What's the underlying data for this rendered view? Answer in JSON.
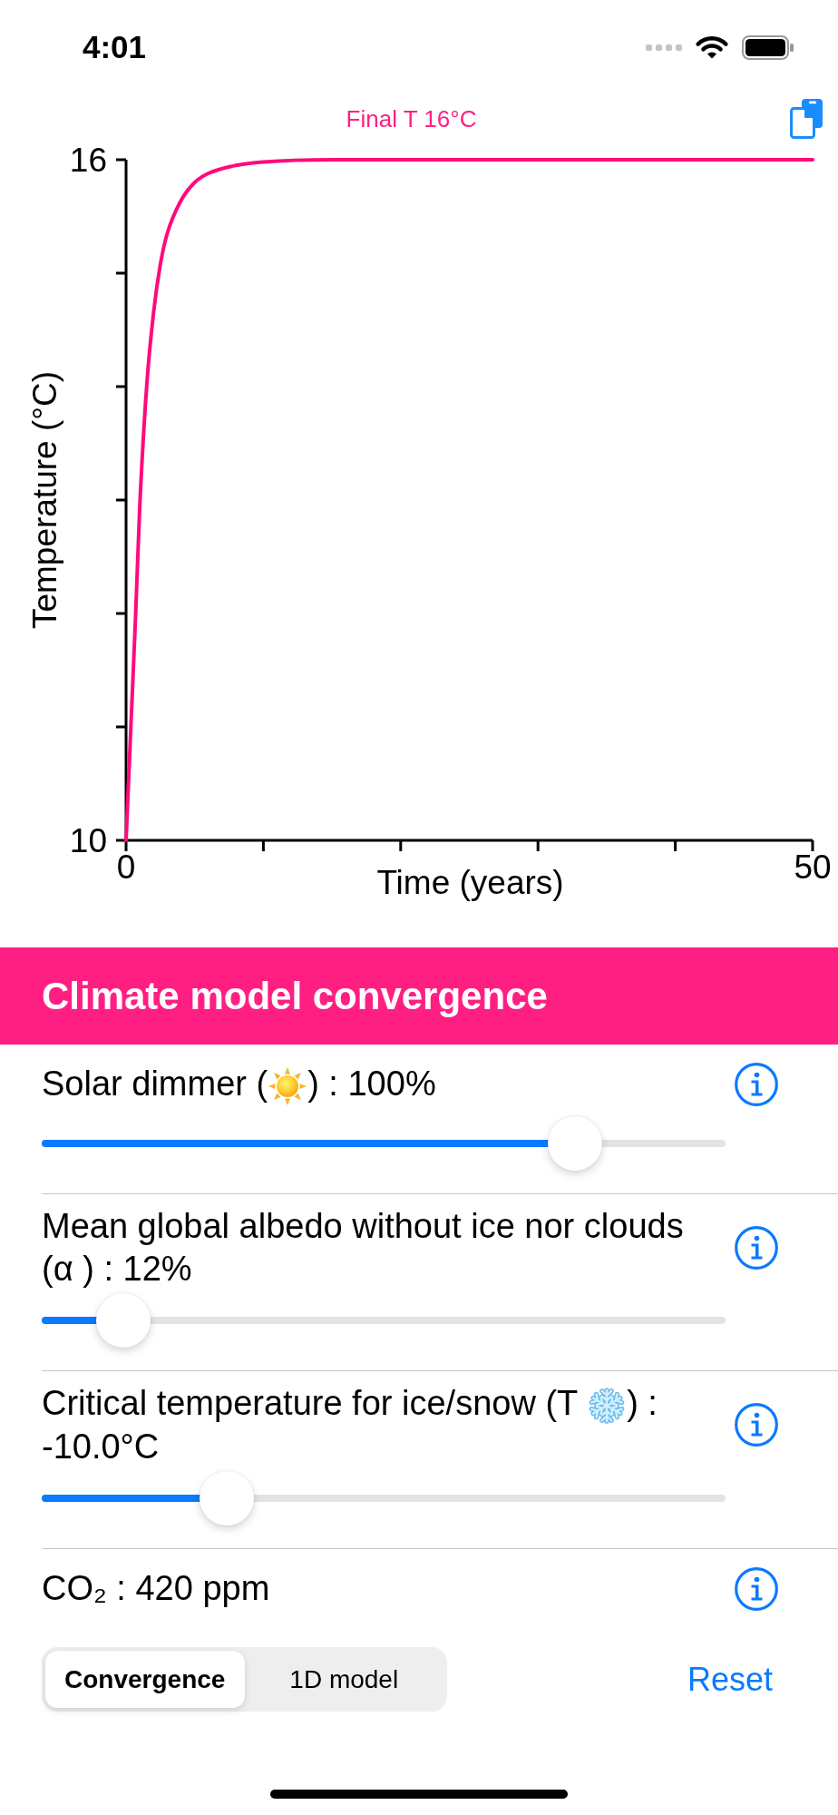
{
  "status_bar": {
    "time": "4:01"
  },
  "chart": {
    "chart_data": {
      "type": "line",
      "title": "Final T 16°C",
      "xlabel": "Time (years)",
      "ylabel": "Temperature (°C)",
      "x": [
        0,
        0.35,
        0.7,
        1,
        1.5,
        2,
        2.5,
        3,
        4,
        5,
        6,
        8,
        10,
        15,
        20,
        30,
        40,
        50
      ],
      "series": [
        {
          "color": "#ff0a7b",
          "values": [
            10,
            11,
            12,
            12.95,
            14,
            14.65,
            15.08,
            15.35,
            15.64,
            15.8,
            15.88,
            15.95,
            15.98,
            16,
            16,
            16,
            16,
            16
          ]
        }
      ],
      "xlim": [
        0,
        50
      ],
      "ylim": [
        10,
        16
      ],
      "xticks": [
        0,
        50
      ],
      "yticks": [
        10,
        16
      ]
    }
  },
  "section": {
    "title": "Climate model convergence",
    "sliders": [
      {
        "label": [
          {
            "kind": "text",
            "text": "Solar dimmer ("
          },
          {
            "kind": "sun"
          },
          {
            "kind": "text",
            "text": ") : 100%"
          }
        ],
        "level": 0.78
      },
      {
        "label": [
          {
            "kind": "text",
            "text": "Mean global albedo without ice nor clouds (α ) : 12%"
          }
        ],
        "level": 0.12
      },
      {
        "label": [
          {
            "kind": "text",
            "text": "Critical temperature for ice/snow (T "
          },
          {
            "kind": "snowflake"
          },
          {
            "kind": "text",
            "text": ") :"
          },
          {
            "kind": "text",
            "text": "-10.0°C"
          }
        ],
        "level": 0.27
      },
      {
        "label": [
          {
            "kind": "text",
            "text": "CO₂ : 420 ppm"
          }
        ]
      }
    ]
  },
  "toolbar": {
    "segments": [
      {
        "label": "Convergence",
        "selected": true
      },
      {
        "label": "1D model",
        "selected": false
      }
    ],
    "reset": "Reset"
  }
}
